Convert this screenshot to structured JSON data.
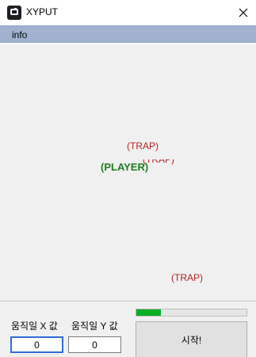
{
  "window": {
    "title": "XYPUT",
    "icon": "app-window-icon",
    "close_icon": "close-icon"
  },
  "menu": {
    "items": [
      {
        "label": "info"
      }
    ]
  },
  "game": {
    "trap_label": "(TRAP)",
    "player_label": "(PLAYER)",
    "colors": {
      "trap": "#b22222",
      "player": "#1c7f1c"
    }
  },
  "controls": {
    "x_label": "움직일 X 값",
    "y_label": "움직일 Y 값",
    "x_value": "0",
    "y_value": "0",
    "progress_fraction": 0.22,
    "progress_color": "#06b025",
    "start_label": "시작!"
  }
}
